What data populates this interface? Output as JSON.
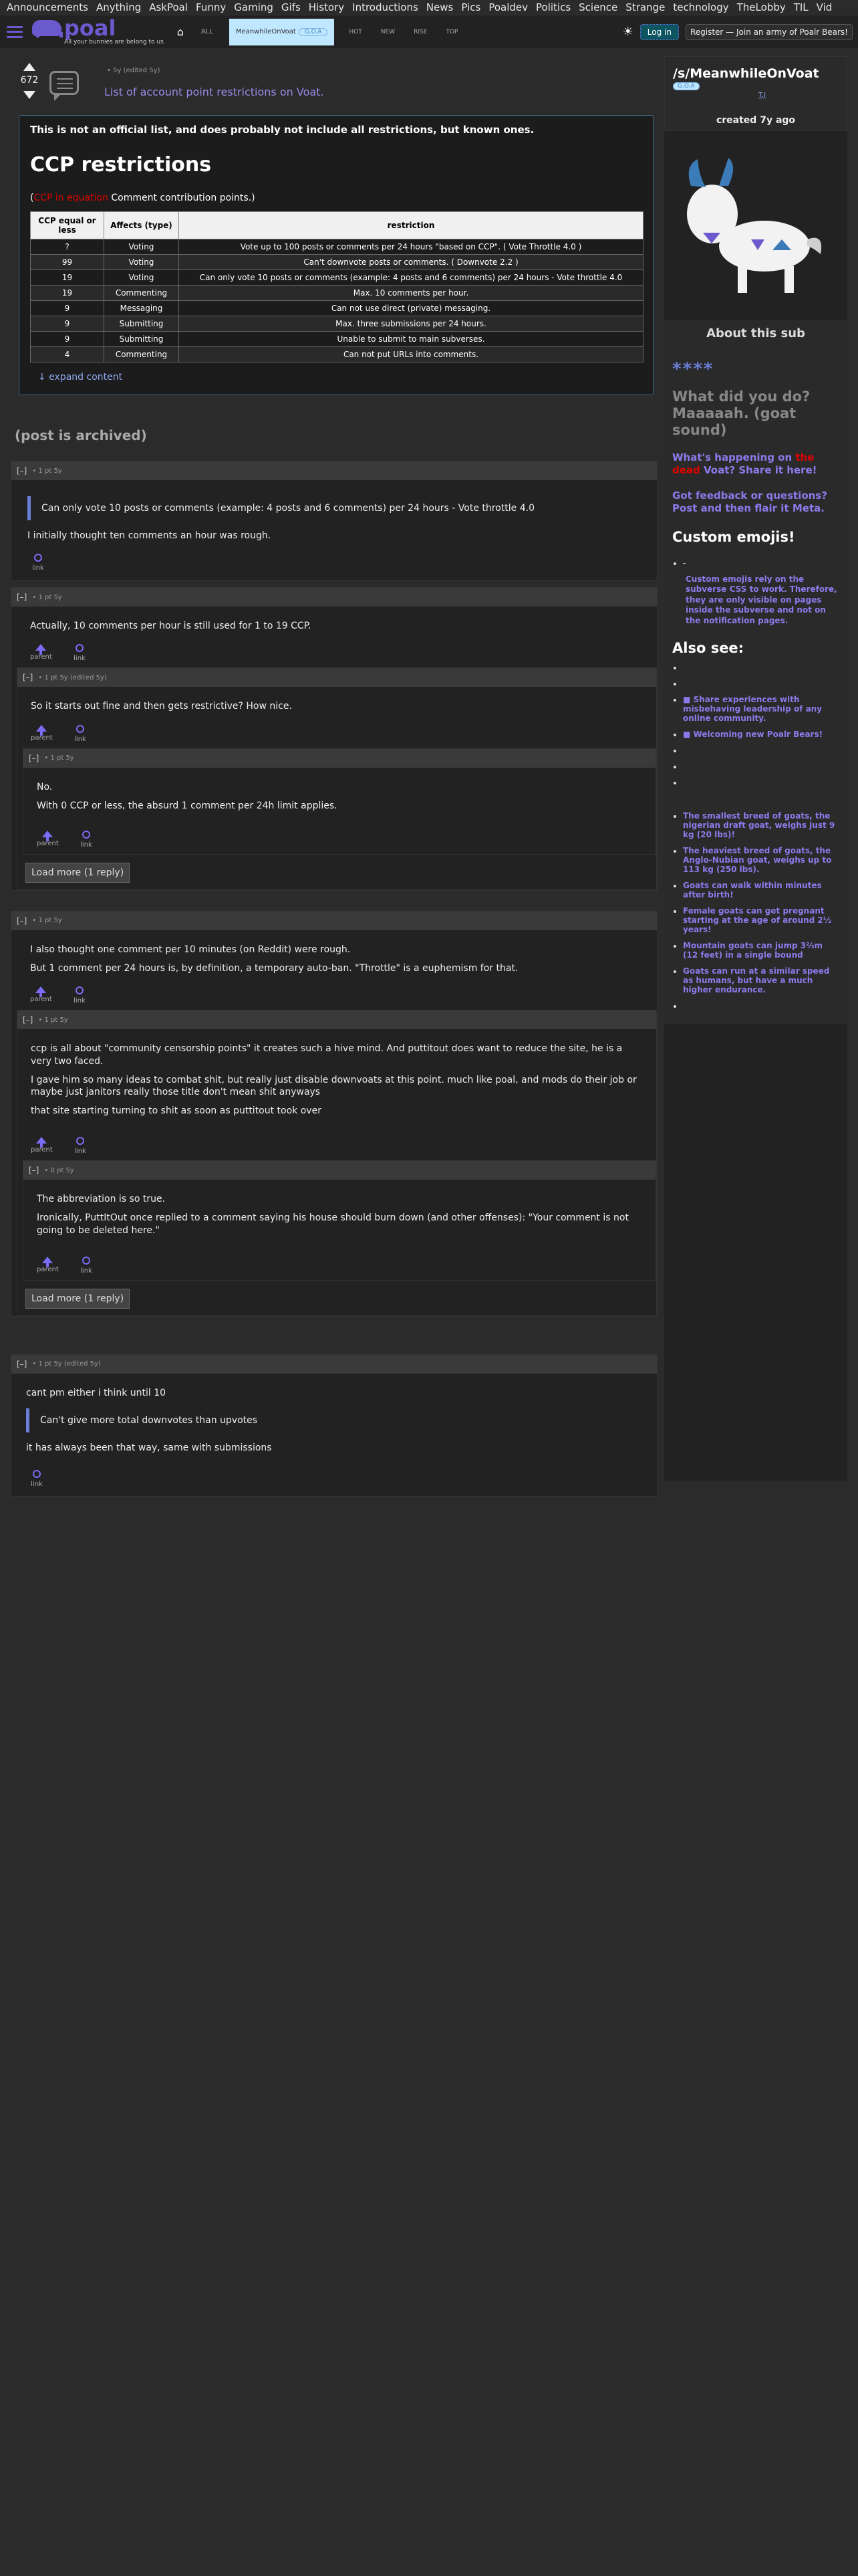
{
  "topnav": [
    "Announcements",
    "Anything",
    "AskPoal",
    "Funny",
    "Gaming",
    "Gifs",
    "History",
    "Introductions",
    "News",
    "Pics",
    "Poaldev",
    "Politics",
    "Science",
    "Strange",
    "technology",
    "TheLobby",
    "TIL",
    "Vid"
  ],
  "header": {
    "logo": "poal",
    "tagline": "All your bunnies are belong to us",
    "sort_label": "ALL",
    "sub_tab": "MeanwhileOnVoat",
    "sub_tab_pill": "G.O.A",
    "tabs": [
      "HOT",
      "NEW",
      "RISE",
      "TOP"
    ],
    "login": "Log in",
    "register": "Register — Join an army of Poalr Bears!"
  },
  "post": {
    "score": "672",
    "meta": "• 5y (edited 5y)",
    "title": "List of account point restrictions on Voat.",
    "intro": "This is not an official list, and does probably not include all restrictions, but known ones.",
    "heading": "CCP restrictions",
    "legend_open": "(",
    "legend_red": "CCP in equation",
    "legend_rest": " Comment contribution points.)",
    "table": {
      "headers": [
        "CCP equal or less",
        "Affects (type)",
        "restriction"
      ],
      "rows": [
        [
          "?",
          "Voting",
          "Vote up to 100 posts or comments per 24 hours \"based on CCP\". ( Vote Throttle 4.0 )"
        ],
        [
          "99",
          "Voting",
          "Can't downvote posts or comments. ( Downvote 2.2 )"
        ],
        [
          "19",
          "Voting",
          "Can only vote 10 posts or comments (example: 4 posts and 6 comments) per 24 hours - Vote throttle 4.0"
        ],
        [
          "19",
          "Commenting",
          "Max. 10 comments per hour."
        ],
        [
          "9",
          "Messaging",
          "Can not use direct (private) messaging."
        ],
        [
          "9",
          "Submitting",
          "Max. three submissions per 24 hours."
        ],
        [
          "9",
          "Submitting",
          "Unable to submit to main subverses."
        ],
        [
          "4",
          "Commenting",
          "Can not put URLs into comments."
        ]
      ]
    },
    "expand": "↓ expand content",
    "archived": "(post is archived)"
  },
  "comments": {
    "c1": {
      "meta": "• 1 pt 5y",
      "quote": "Can only vote 10 posts or comments (example: 4 posts and 6 comments) per 24 hours - Vote throttle 4.0",
      "text": "I initially thought ten comments an hour was rough.",
      "link": "link"
    },
    "c2": {
      "meta": "• 1 pt 5y",
      "text": "Actually, 10 comments per hour is still used for 1 to 19 CCP.",
      "parent": "parent",
      "link": "link"
    },
    "c3": {
      "meta": "• 1 pt 5y (edited 5y)",
      "text": "So it starts out fine and then gets restrictive? How nice.",
      "parent": "parent",
      "link": "link"
    },
    "c4": {
      "meta": "• 1 pt 5y",
      "text1": "No.",
      "text2": "With 0 CCP or less, the absurd 1 comment per 24h limit applies.",
      "parent": "parent",
      "link": "link"
    },
    "loadmore1": "Load more (1 reply)",
    "c5": {
      "meta": "• 1 pt 5y",
      "text1": "I also thought one comment per 10 minutes (on Reddit) were rough.",
      "text2": "But 1 comment per 24 hours is, by definition, a temporary auto-ban. \"Throttle\" is a euphemism for that.",
      "parent": "parent",
      "link": "link"
    },
    "c6": {
      "meta": "• 1 pt 5y",
      "text1": "ccp is all about \"community censorship points\" it creates such a hive mind. And puttitout does want to reduce the site, he is a very two faced.",
      "text2": "I gave him so many ideas to combat shit, but really just disable downvoats at this point. much like poal, and mods do their job or maybe just janitors really those title don't mean shit anyways",
      "text3": "that site starting turning to shit as soon as puttitout took over",
      "parent": "parent",
      "link": "link"
    },
    "c7": {
      "meta": "• 0 pt 5y",
      "text1": "The abbreviation is so true.",
      "text2": "Ironically, PuttItOut once replied to a comment saying his house should burn down (and other offenses): \"Your comment is not going to be deleted here.\"",
      "parent": "parent",
      "link": "link"
    },
    "loadmore2": "Load more (1 reply)",
    "c8": {
      "meta": "• 1 pt 5y (edited 5y)",
      "text1": "cant pm either i think until 10",
      "quote": "Can't give more total downvotes than upvotes",
      "text2": "it has always been that way, same with submissions",
      "link": "link"
    }
  },
  "sidebar": {
    "title": "/s/MeanwhileOnVoat",
    "badge": "G.O.A",
    "ti": "T.I",
    "created": "created 7y ago",
    "about": "About this sub",
    "stars": "****",
    "what": "What did you do? Maaaaah. (goat sound)",
    "happening_pre": "What's happening on ",
    "happening_red": "the dead",
    "happening_post": " Voat? Share it here!",
    "feedback": "Got feedback or questions? Post and then flair it Meta.",
    "emojis": "Custom emojis!",
    "emoji_bullet": "-",
    "emoji_note": "Custom emojis rely on the subverse CSS to work. Therefore, they are only visible on pages inside the subverse and not on the notification pages.",
    "alsosee": "Also see:",
    "see_items": [
      "",
      "",
      "■ Share experiences with misbehaving leadership of any online community.",
      "■ Welcoming new Poalr Bears!",
      "",
      "",
      ""
    ],
    "facts": [
      "The smallest breed of goats, the nigerian draft goat, weighs just 9 kg (20 lbs)!",
      "The heaviest breed of goats, the Anglo-Nubian goat, weighs up to 113 kg (250 lbs).",
      "Goats can walk within minutes after birth!",
      "Female goats can get pregnant starting at the age of around 2½ years!",
      "Mountain goats can jump 3⅔m (12 feet) in a single bound",
      "Goats can run at a similar speed as humans, but have a much higher endurance.",
      ""
    ]
  },
  "colors": {
    "accent": "#6a5acd",
    "link": "#9b8bea",
    "quote_bar": "#6a7fd8",
    "warning_red": "#dd0000"
  }
}
